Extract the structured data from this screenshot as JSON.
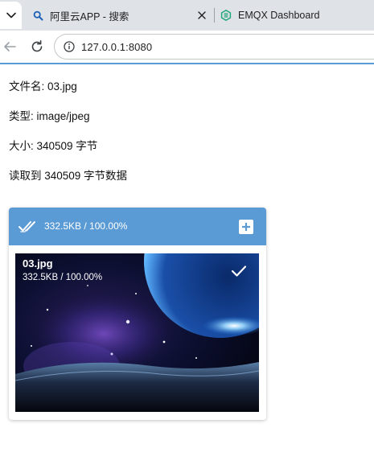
{
  "browser": {
    "tabs": [
      {
        "label": "阿里云APP - 搜索"
      },
      {
        "label": "EMQX Dashboard"
      }
    ],
    "url": "127.0.0.1:8080"
  },
  "page": {
    "filename_line": "文件名: 03.jpg",
    "type_line": "类型: image/jpeg",
    "size_line": "大小: 340509 字节",
    "read_line": "读取到 340509 字节数据"
  },
  "uploader": {
    "summary": "332.5KB / 100.00%",
    "file": {
      "name": "03.jpg",
      "progress_text": "332.5KB / 100.00%",
      "progress": 1.0
    },
    "colors": {
      "header": "#5b9bd5"
    }
  },
  "icons": {
    "tab_menu": "chevron-down-icon",
    "tab1_favicon": "search-icon",
    "tab2_favicon": "emqx-logo-icon",
    "tab_close": "close-icon",
    "back": "arrow-left-icon",
    "reload": "reload-icon",
    "site_info": "info-icon",
    "header_status": "double-check-icon",
    "add": "plus-icon",
    "file_status": "check-icon"
  }
}
